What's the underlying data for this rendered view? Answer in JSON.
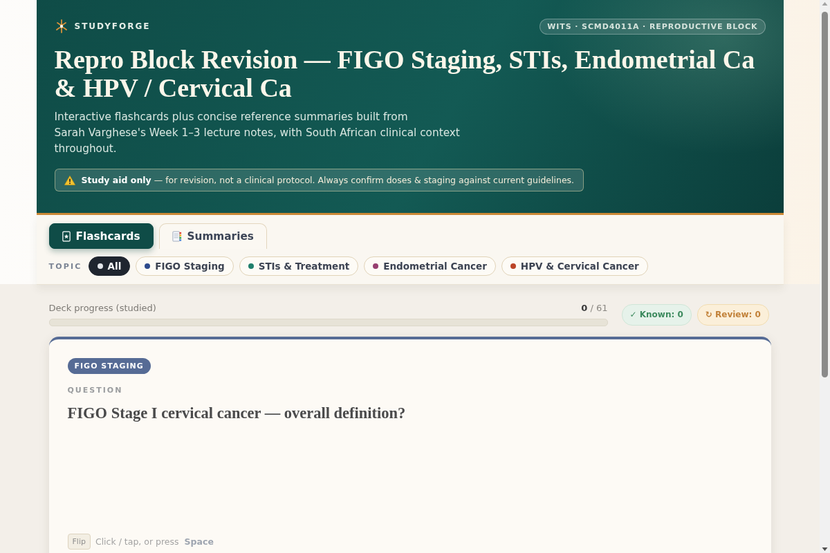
{
  "brand": {
    "name": "STUDYFORGE"
  },
  "course_badge": "WITS · SCMD4011A · REPRODUCTIVE BLOCK",
  "header": {
    "title": "Repro Block Revision — FIGO Staging, STIs, Endometrial Ca & HPV / Cervical Ca",
    "subtitle": "Interactive flashcards plus concise reference summaries built from\nSarah Varghese's Week 1–3 lecture notes, with South African clinical context throughout.",
    "notice": "**Study aid only** — for revision, not a clinical protocol. Always confirm doses & staging against current guidelines."
  },
  "tabs": [
    {
      "label": "Flashcards",
      "kind": "flashcards",
      "selected": true
    },
    {
      "label": "Summaries",
      "kind": "summaries",
      "selected": false
    }
  ],
  "topic_filter": {
    "label": "TOPIC",
    "chips": [
      {
        "label": "All",
        "color": "#e4e6ea",
        "selected": true
      },
      {
        "label": "FIGO Staging",
        "color": "#2d4a8c",
        "selected": false
      },
      {
        "label": "STIs & Treatment",
        "color": "#1f7f6c",
        "selected": false
      },
      {
        "label": "Endometrial Cancer",
        "color": "#973f70",
        "selected": false
      },
      {
        "label": "HPV & Cervical Cancer",
        "color": "#bb4428",
        "selected": false
      }
    ]
  },
  "progress": {
    "label": "Deck progress (studied)",
    "count": "**0** / 61",
    "level": 0
  },
  "tallies": [
    {
      "kind": "known",
      "text": "✓ Known: 0"
    },
    {
      "kind": "review",
      "text": "↻ Review: 0"
    }
  ],
  "card": {
    "topic": "FIGO STAGING",
    "side_label": "QUESTION",
    "text": "FIGO Stage I cervical cancer — overall definition?",
    "flip_key": "Flip",
    "hint": "Click / tap, or press",
    "hint_key": "Space"
  }
}
